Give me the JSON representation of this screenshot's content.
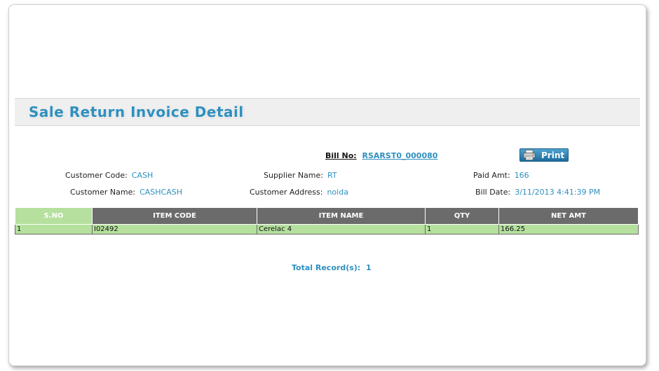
{
  "page": {
    "title": "Sale Return Invoice Detail"
  },
  "bill": {
    "label": "Bill No:",
    "value": "RSARST0_000080"
  },
  "print_button": {
    "label": "Print",
    "icon": "printer-icon"
  },
  "info": {
    "customer_code": {
      "label": "Customer Code:",
      "value": "CASH"
    },
    "customer_name": {
      "label": "Customer Name:",
      "value": "CASHCASH"
    },
    "supplier_name": {
      "label": "Supplier Name:",
      "value": "RT"
    },
    "customer_address": {
      "label": "Customer Address:",
      "value": "noida"
    },
    "paid_amt": {
      "label": "Paid Amt:",
      "value": "166"
    },
    "bill_date": {
      "label": "Bill Date:",
      "value": "3/11/2013 4:41:39 PM"
    }
  },
  "table": {
    "headers": [
      "S.NO",
      "ITEM CODE",
      "ITEM NAME",
      "QTY",
      "NET AMT"
    ],
    "rows": [
      [
        "1",
        "I02492",
        "Cerelac 4",
        "1",
        "166.25"
      ]
    ]
  },
  "total": {
    "label": "Total Record(s):",
    "value": "1"
  },
  "colors": {
    "accent": "#2f8fbf",
    "header_gray": "#6b6b6b",
    "row_green": "#b5e09e"
  }
}
